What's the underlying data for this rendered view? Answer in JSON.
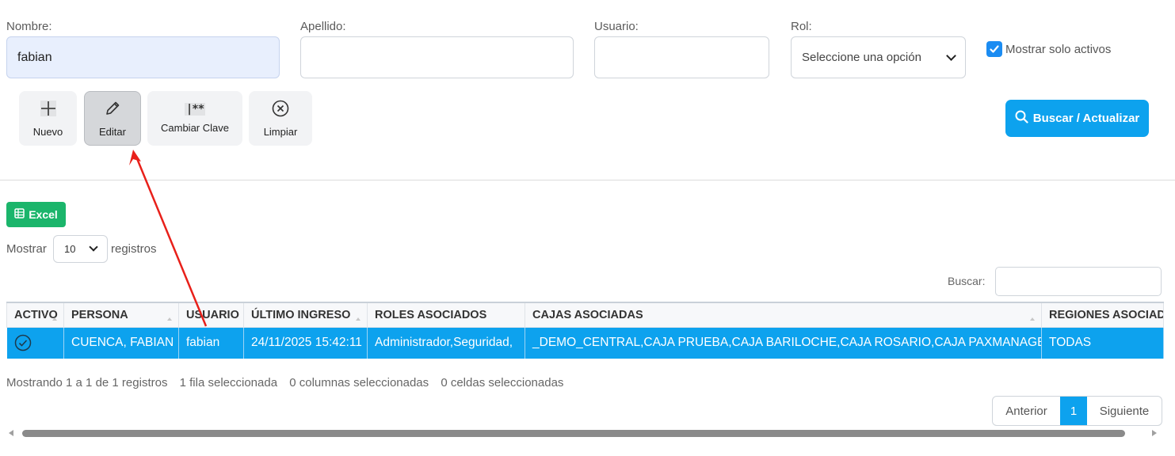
{
  "filters": {
    "nombre_label": "Nombre:",
    "nombre_value": "fabian",
    "apellido_label": "Apellido:",
    "apellido_value": "",
    "usuario_label": "Usuario:",
    "usuario_value": "",
    "rol_label": "Rol:",
    "rol_selected": "Seleccione una opción",
    "mostrar_activos_label": "Mostrar solo activos",
    "mostrar_activos_checked": true
  },
  "toolbar": {
    "nuevo": "Nuevo",
    "editar": "Editar",
    "cambiar_clave": "Cambiar Clave",
    "cambiar_clave_icon_text": "|**",
    "limpiar": "Limpiar",
    "buscar": "Buscar / Actualizar"
  },
  "table_tools": {
    "excel": "Excel",
    "mostrar": "Mostrar",
    "page_length": "10",
    "registros": "registros",
    "buscar_label": "Buscar:"
  },
  "table": {
    "headers": [
      "ACTIVO",
      "PERSONA",
      "USUARIO",
      "ÚLTIMO INGRESO",
      "ROLES ASOCIADOS",
      "CAJAS ASOCIADAS",
      "REGIONES ASOCIADAS"
    ],
    "rows": [
      {
        "activo": "check-circle-icon",
        "persona": "CUENCA, FABIAN",
        "usuario": "fabian",
        "ultimo_ingreso": "24/11/2025 15:42:11",
        "roles": "Administrador,Seguridad,",
        "cajas": "_DEMO_CENTRAL,CAJA PRUEBA,CAJA BARILOCHE,CAJA ROSARIO,CAJA PAXMANAGER,",
        "regiones": "TODAS",
        "selected": true
      }
    ]
  },
  "status": {
    "showing": "Mostrando 1 a 1 de 1 registros",
    "rows_selected": "1 fila seleccionada",
    "cols_selected": "0 columnas seleccionadas",
    "cells_selected": "0 celdas seleccionadas"
  },
  "pagination": {
    "prev": "Anterior",
    "current": "1",
    "next": "Siguiente"
  },
  "colors": {
    "primary": "#0da2ee",
    "excel": "#1bb56b",
    "annotation_arrow": "#e8201a"
  }
}
